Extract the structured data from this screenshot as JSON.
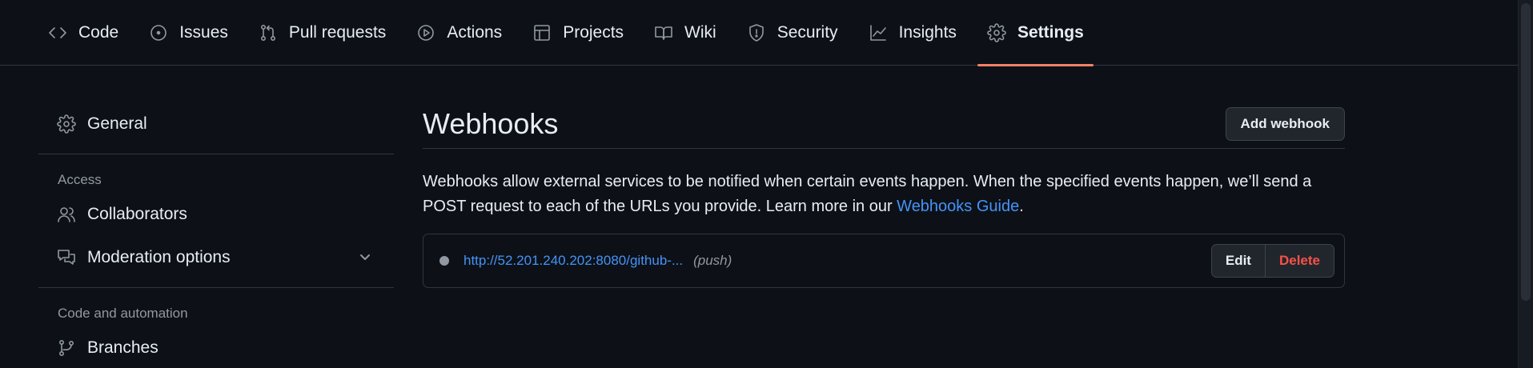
{
  "nav": {
    "items": [
      {
        "label": "Code",
        "icon": "code-icon"
      },
      {
        "label": "Issues",
        "icon": "issue-icon"
      },
      {
        "label": "Pull requests",
        "icon": "pull-request-icon"
      },
      {
        "label": "Actions",
        "icon": "play-icon"
      },
      {
        "label": "Projects",
        "icon": "table-icon"
      },
      {
        "label": "Wiki",
        "icon": "book-icon"
      },
      {
        "label": "Security",
        "icon": "shield-icon"
      },
      {
        "label": "Insights",
        "icon": "graph-icon"
      },
      {
        "label": "Settings",
        "icon": "gear-icon"
      }
    ],
    "active": "Settings",
    "accent_color": "#f78166"
  },
  "sidebar": {
    "general": {
      "label": "General",
      "icon": "gear-icon"
    },
    "access_heading": "Access",
    "collaborators": {
      "label": "Collaborators",
      "icon": "people-icon"
    },
    "moderation": {
      "label": "Moderation options",
      "icon": "comment-discussion-icon"
    },
    "code_automation_heading": "Code and automation",
    "branches": {
      "label": "Branches",
      "icon": "git-branch-icon"
    }
  },
  "main": {
    "title": "Webhooks",
    "add_button": "Add webhook",
    "description_text": "Webhooks allow external services to be notified when certain events happen. When the specified events happen, we’ll send a POST request to each of the URLs you provide. Learn more in our ",
    "description_link": "Webhooks Guide",
    "description_end": ".",
    "webhooks": [
      {
        "url": "http://52.201.240.202:8080/github-...",
        "events": "(push)",
        "status_color": "#9198a1",
        "edit_label": "Edit",
        "delete_label": "Delete"
      }
    ]
  },
  "colors": {
    "background": "#0d1117",
    "link": "#4493f8",
    "danger": "#f85149"
  }
}
